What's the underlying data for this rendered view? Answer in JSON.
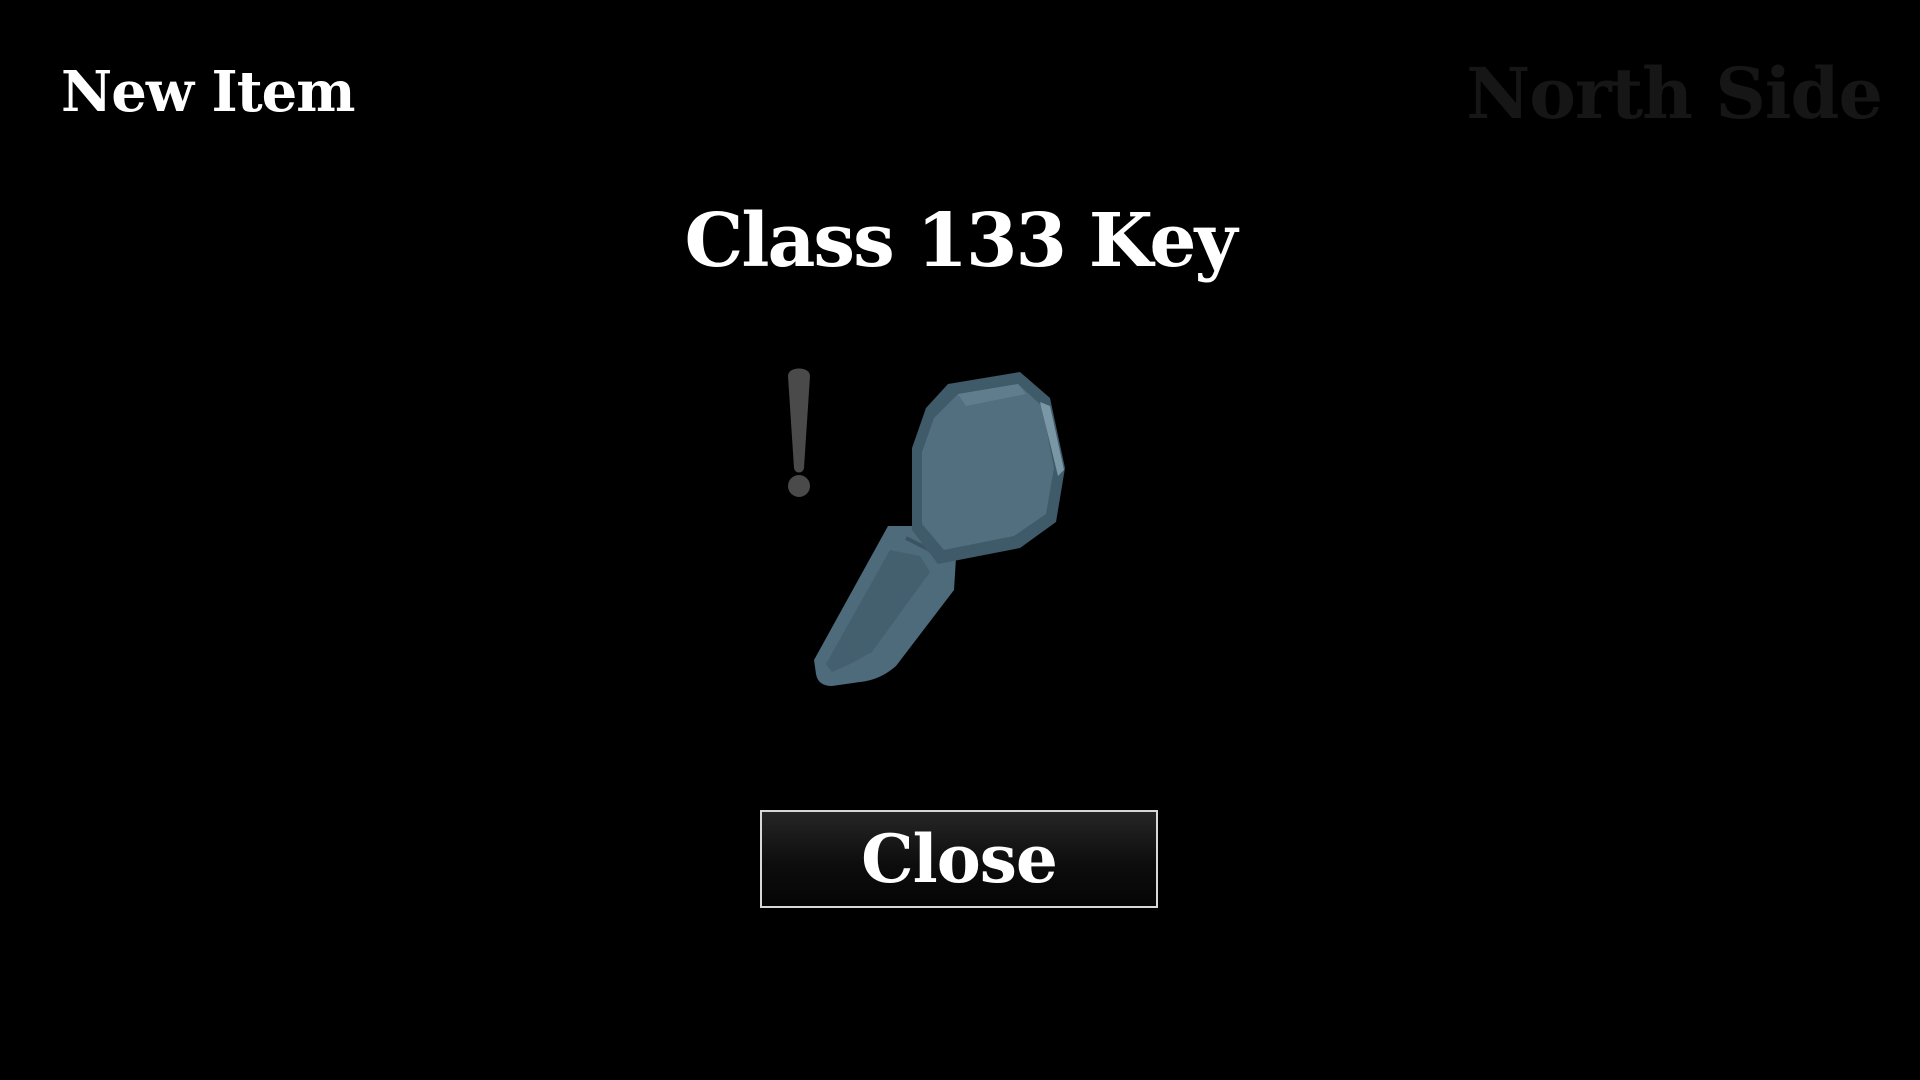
{
  "header": {
    "left_label": "New Item",
    "right_label": "North Side"
  },
  "item": {
    "name": "Class 133 Key",
    "icon": "key-icon",
    "alert_icon": "exclamation-icon",
    "key_color": "#4d6b7b",
    "alert_color": "#4a4a4a"
  },
  "actions": {
    "close_label": "Close"
  },
  "colors": {
    "background": "#000000",
    "text": "#ffffff",
    "right_label": "#161616",
    "button_border": "#d8d8d8"
  }
}
